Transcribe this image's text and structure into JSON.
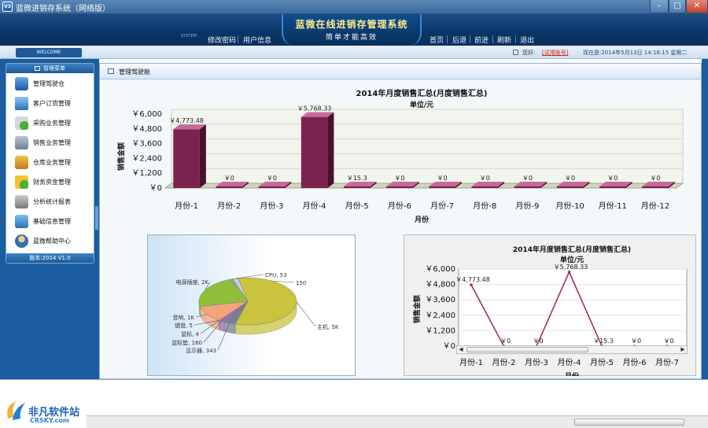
{
  "window": {
    "title": "蓝微进销存系统（网络版）",
    "icon_text": "V3",
    "minimize": "–",
    "maximize": "□",
    "close": "✕"
  },
  "banner": {
    "title": "蓝微在线进销存管理系统",
    "slogan": "简单才能高效",
    "system_tag": "SYSTEM",
    "nav_left": [
      "修改密码",
      "用户信息"
    ],
    "nav_right": [
      "首页",
      "后退",
      "前进",
      "刷新",
      "退出"
    ]
  },
  "status": {
    "welcome": "WELCOME",
    "user_label": "您好:",
    "user_link": "[试用账号]",
    "datetime": "现在是:2014年5月13日  14:16:15 星期二"
  },
  "sidebar": {
    "header": "管理菜单",
    "footer": "版本:2014 V1.0",
    "items": [
      {
        "label": "管理驾驶仓",
        "icon": "dashboard-icon"
      },
      {
        "label": "客户订货管理",
        "icon": "monitor-icon"
      },
      {
        "label": "采购业务管理",
        "icon": "cart-icon"
      },
      {
        "label": "销售业务管理",
        "icon": "calculator-icon"
      },
      {
        "label": "仓库业务管理",
        "icon": "warehouse-icon"
      },
      {
        "label": "财务资金管理",
        "icon": "coins-icon"
      },
      {
        "label": "分析统计报表",
        "icon": "report-icon"
      },
      {
        "label": "基础信息管理",
        "icon": "settings-icon"
      },
      {
        "label": "蓝微帮助中心",
        "icon": "help-icon"
      }
    ]
  },
  "main_tab": {
    "label": "管理驾驶舱"
  },
  "chart_data": [
    {
      "type": "bar",
      "title": "2014年月度销售汇总(月度销售汇总)",
      "subtitle": "单位/元",
      "xlabel": "月份",
      "ylabel": "销售金额",
      "ylim": [
        0,
        6000
      ],
      "yticks": [
        "￥0",
        "￥1,200",
        "￥2,400",
        "￥3,600",
        "￥4,800",
        "￥6,000"
      ],
      "categories": [
        "月份-1",
        "月份-2",
        "月份-3",
        "月份-4",
        "月份-5",
        "月份-6",
        "月份-7",
        "月份-8",
        "月份-9",
        "月份-10",
        "月份-11",
        "月份-12"
      ],
      "values": [
        4773.48,
        0,
        0,
        5768.33,
        15.3,
        0,
        0,
        0,
        0,
        0,
        0,
        0
      ],
      "labels": [
        "￥4,773.48",
        "￥0",
        "￥0",
        "￥5,768.33",
        "￥15.3",
        "￥0",
        "￥0",
        "￥0",
        "￥0",
        "￥0",
        "￥0",
        "￥0"
      ],
      "grid": true,
      "color": "#7a2350"
    },
    {
      "type": "pie",
      "slices": [
        {
          "label": "CPU",
          "value": 53,
          "text": "CPU, 53",
          "color": "#8ea7d8"
        },
        {
          "label": "",
          "value": 150,
          "text": "150",
          "color": "#c9cfe0"
        },
        {
          "label": "主机",
          "value": 5000,
          "text": "主机, 5K",
          "color": "#c9c33e"
        },
        {
          "label": "显示器",
          "value": 343,
          "text": "显示器, 343",
          "color": "#7b7c98"
        },
        {
          "label": "鼠标垫",
          "value": 160,
          "text": "鼠标垫, 160",
          "color": "#9a6fb0"
        },
        {
          "label": "鼠标",
          "value": 4,
          "text": "鼠标, 4",
          "color": "#d9845a"
        },
        {
          "label": "键盘",
          "value": 5,
          "text": "键盘, 5",
          "color": "#e59a6c"
        },
        {
          "label": "音响",
          "value": 1000,
          "text": "音响, 1K",
          "color": "#f2a47a"
        },
        {
          "label": "电源插座",
          "value": 2000,
          "text": "电源插座, 2K",
          "color": "#8fbf3a"
        }
      ]
    },
    {
      "type": "line",
      "title": "2014年月度销售汇总(月度销售汇总)",
      "subtitle": "单位/元",
      "xlabel": "月份",
      "ylabel": "销售金额",
      "ylim": [
        0,
        6000
      ],
      "yticks": [
        "￥0",
        "￥1,200",
        "￥2,400",
        "￥3,600",
        "￥4,800",
        "￥6,000"
      ],
      "categories": [
        "月份-1",
        "月份-2",
        "月份-3",
        "月份-4",
        "月份-5",
        "月份-6",
        "月份-7"
      ],
      "values": [
        4773.48,
        0,
        0,
        5768.33,
        15.3,
        0,
        0
      ],
      "labels": [
        "￥4,773.48",
        "￥0",
        "￥0",
        "￥5,768.33",
        "￥15.3",
        "￥0",
        "￥0"
      ],
      "color": "#a0306a"
    }
  ],
  "watermark": {
    "cn": "非凡软件站",
    "en": "CRSKY.com"
  }
}
